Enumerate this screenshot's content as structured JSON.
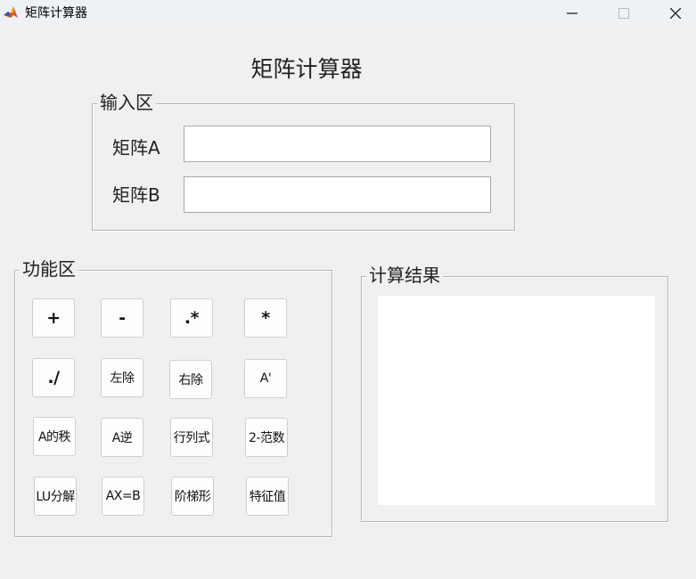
{
  "window": {
    "title": "矩阵计算器",
    "controls": {
      "minimize": "minimize-icon",
      "maximize": "maximize-icon",
      "close": "close-icon"
    },
    "icon": "matlab-logo-icon"
  },
  "heading": "矩阵计算器",
  "input_group": {
    "title": "输入区",
    "matrix_a_label": "矩阵A",
    "matrix_a_value": "",
    "matrix_b_label": "矩阵B",
    "matrix_b_value": ""
  },
  "function_group": {
    "title": "功能区",
    "rows": [
      [
        "+",
        "-",
        ".*",
        "*"
      ],
      [
        "./",
        "左除",
        "右除",
        "A'"
      ],
      [
        "A的秩",
        "A逆",
        "行列式",
        "2-范数"
      ],
      [
        "LU分解",
        "AX=B",
        "阶梯形",
        "特征值"
      ]
    ]
  },
  "result_group": {
    "title": "计算结果",
    "value": ""
  },
  "colors": {
    "background": "#f0f0f0",
    "titlebar": "#eef2f7",
    "border": "#b5b5b5",
    "field": "#ffffff"
  }
}
